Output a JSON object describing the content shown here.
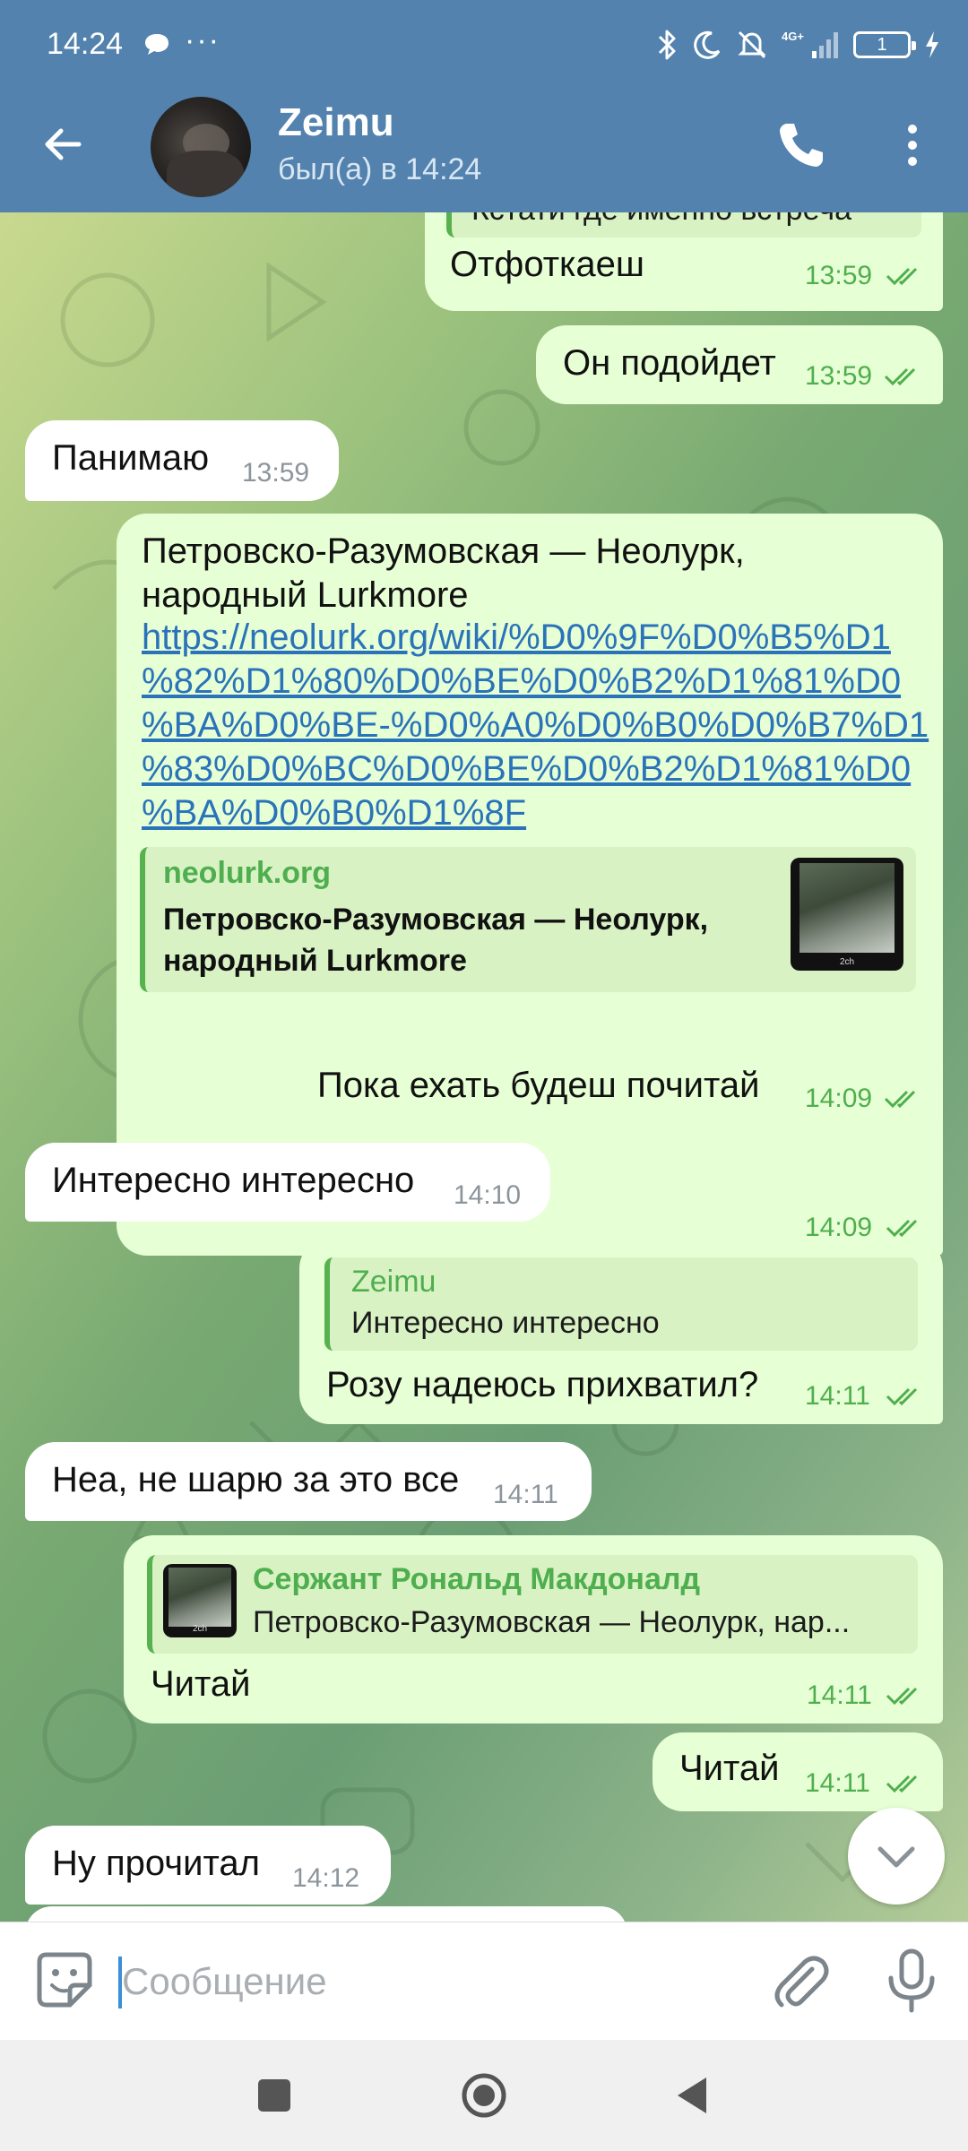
{
  "status_bar": {
    "time": "14:24",
    "dots": "···",
    "battery": "1"
  },
  "header": {
    "name": "Zeimu",
    "status": "был(а) в 14:24"
  },
  "messages": [
    {
      "dir": "out",
      "quote_text": "Кстати где именно встреча",
      "text": "Отфоткаеш",
      "time": "13:59"
    },
    {
      "dir": "out",
      "text": "Он подойдет",
      "time": "13:59"
    },
    {
      "dir": "in",
      "text": "Панимаю",
      "time": "13:59"
    },
    {
      "dir": "out",
      "text_line1": "Петровско-Разумовская — Неолурк,",
      "text_line2": "народный Lurkmore",
      "link_lines": [
        "https://neolurk.org/wiki/%D0%9F%D0%B5%D1",
        "%82%D1%80%D0%BE%D0%B2%D1%81%D0",
        "%BA%D0%BE-%D0%A0%D0%B0%D0%B7%D1",
        "%83%D0%BC%D0%BE%D0%B2%D1%81%D0",
        "%BA%D0%B0%D1%8F"
      ],
      "preview_site": "neolurk.org",
      "preview_title_line1": "Петровско-Разумовская — Неолурк,",
      "preview_title_line2": "народный Lurkmore",
      "thumb_label": "2ch",
      "time": "14:09"
    },
    {
      "dir": "out",
      "text": "Пока ехать будеш почитай",
      "time": "14:09"
    },
    {
      "dir": "in",
      "text": "Интересно интересно",
      "time": "14:10"
    },
    {
      "dir": "out",
      "quote_name": "Zeimu",
      "quote_text": "Интересно интересно",
      "text": "Розу надеюсь прихватил?",
      "time": "14:11"
    },
    {
      "dir": "in",
      "text": "Неа, не шарю за это все",
      "time": "14:11"
    },
    {
      "dir": "out",
      "quote_name": "Сержант Рональд Макдоналд",
      "quote_text": "Петровско-Разумовская — Неолурк, нар...",
      "thumb_label": "2ch",
      "text": "Читай",
      "time": "14:11"
    },
    {
      "dir": "out",
      "text": "Читай",
      "time": "14:11"
    },
    {
      "dir": "in",
      "text": "Ну прочитал",
      "time": "14:12"
    }
  ],
  "composer": {
    "placeholder": "Сообщение"
  },
  "colors": {
    "header": "#5282ad",
    "out_bubble": "#e6ffd4",
    "in_bubble": "#ffffff",
    "accent_green": "#4fae4e",
    "link": "#2a73ba"
  },
  "icons": [
    "back-arrow-icon",
    "phone-icon",
    "more-vert-icon",
    "sticker-icon",
    "paperclip-icon",
    "microphone-icon",
    "chevron-down-icon",
    "double-check-icon",
    "bluetooth-icon",
    "moon-icon",
    "muted-bell-icon",
    "signal-icon",
    "battery-icon",
    "charging-icon",
    "chat-bubble-icon"
  ]
}
